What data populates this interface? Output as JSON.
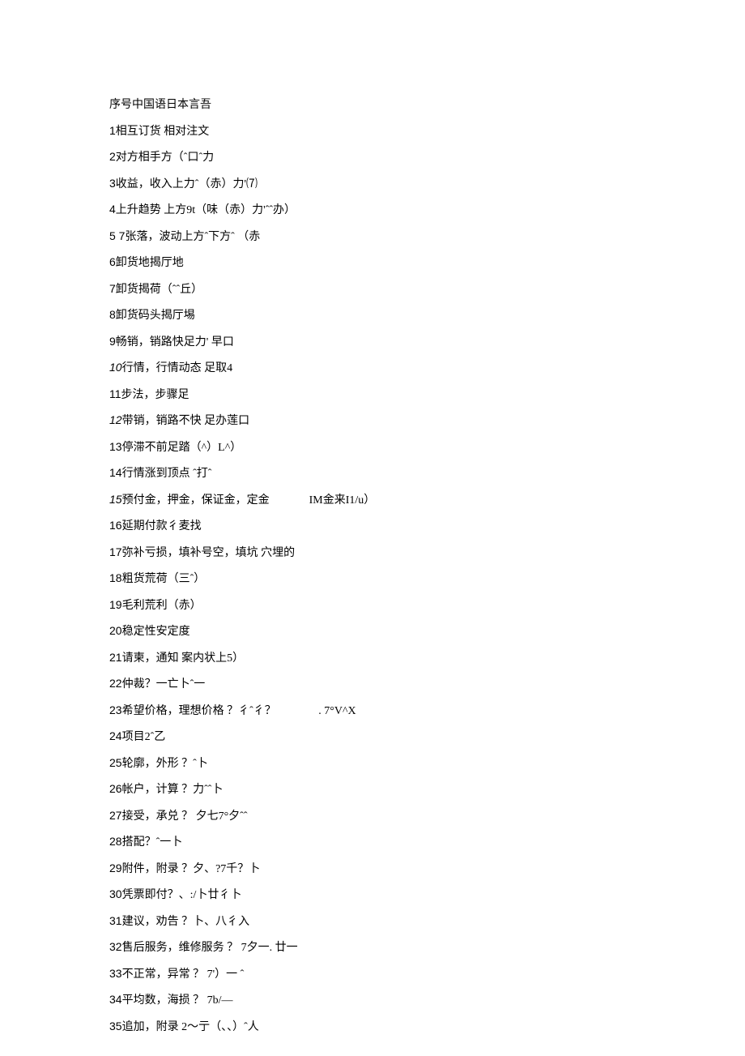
{
  "header": "序号中国语日本言吾",
  "lines": [
    {
      "no": "1",
      "text": "相互订货 相对注文",
      "italic": false
    },
    {
      "no": "2",
      "text": "对方相手方（ˆ口ˆ力",
      "italic": false
    },
    {
      "no": "3",
      "text": "收益，收入上力ˆ（赤）力'⑺",
      "italic": false
    },
    {
      "no": "4",
      "text": "上升趋势 上方9t（味（赤）力'ˆˆ办）",
      "italic": false
    },
    {
      "no": "5 7",
      "text": "张落，波动上方ˆ下方ˆ （赤",
      "italic": false
    },
    {
      "no": "6",
      "text": "卸货地揭厅地",
      "italic": false
    },
    {
      "no": "7",
      "text": "卸货揭荷（ˆˆ丘）",
      "italic": false
    },
    {
      "no": "8",
      "text": "卸货码头揭厅埸",
      "italic": false
    },
    {
      "no": "9",
      "text": "畅销，销路快足力' 早口",
      "italic": false
    },
    {
      "no": "10",
      "text": "行情，行情动态 足取4",
      "italic": true
    },
    {
      "no": "11",
      "text": "步法，步骤足",
      "italic": false
    },
    {
      "no": "12",
      "text": "带销，销路不快 足办莲口",
      "italic": true
    },
    {
      "no": "13",
      "text": "停滞不前足踏（^）L^）",
      "italic": false
    },
    {
      "no": "14",
      "text": "行情涨到顶点 ˆ打ˆ",
      "italic": false
    },
    {
      "no": "15",
      "text": "预付金，押金，保证金，定金              IM金来I1/u）",
      "italic": true
    },
    {
      "no": "16",
      "text": "延期付款彳麦找",
      "italic": false
    },
    {
      "no": "17",
      "text": "弥补亏损，填补号空，填坑 穴埋的",
      "italic": false
    },
    {
      "no": "18",
      "text": "粗货荒荷（三ˆ）",
      "italic": false
    },
    {
      "no": "19",
      "text": "毛利荒利（赤）",
      "italic": false
    },
    {
      "no": "20",
      "text": "稳定性安定度",
      "italic": false
    },
    {
      "no": "21",
      "text": "请柬，通知 案内状上5）",
      "italic": false
    },
    {
      "no": "22",
      "text": "仲裁？一亡卜ˆ一",
      "italic": false
    },
    {
      "no": "23",
      "text": "希望价格，理想价格 ？彳ˆ彳？               . 7°V^X",
      "italic": false
    },
    {
      "no": "24",
      "text": "项目2ˆ乙",
      "italic": false
    },
    {
      "no": "25",
      "text": "轮廓，外形 ？ˆ卜",
      "italic": false
    },
    {
      "no": "26",
      "text": "帐户，计算 ？力ˆˆ卜",
      "italic": false
    },
    {
      "no": "27",
      "text": "接受，承兑 ？ 夕七7°夕ˆˆ",
      "italic": false
    },
    {
      "no": "28",
      "text": "搭配？ˆ一卜",
      "italic": false
    },
    {
      "no": "29",
      "text": "附件，附录 ？夕、?7千？卜",
      "italic": false
    },
    {
      "no": "30",
      "text": "凭票即付？、:/卜廿彳卜",
      "italic": false
    },
    {
      "no": "31",
      "text": "建议，劝告 ？卜、八彳入",
      "italic": false
    },
    {
      "no": "32",
      "text": "售后服务，维修服务 ？ 7夕一. 廿一",
      "italic": false
    },
    {
      "no": "33",
      "text": "不正常，异常 ？ 7'）一 ˆ",
      "italic": false
    },
    {
      "no": "34",
      "text": "平均数，海损 ？ 7b/—",
      "italic": false
    },
    {
      "no": "35",
      "text": "追加，附录 2〜亍（、、）ˆ人",
      "italic": false
    }
  ]
}
